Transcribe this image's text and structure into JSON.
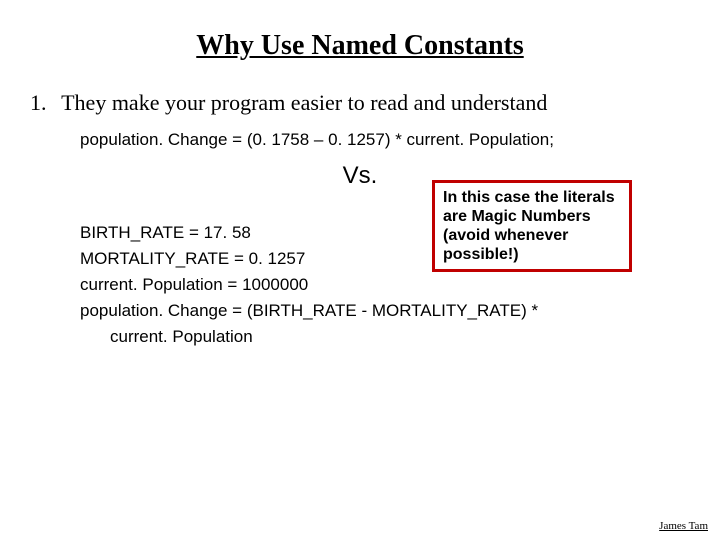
{
  "title": "Why Use Named Constants",
  "bullet": {
    "number": "1.",
    "text": "They make your program easier to read and understand"
  },
  "code_line_1": "population. Change = (0. 1758 – 0. 1257) * current. Population;",
  "vs_label": "Vs.",
  "code_block": {
    "l1": "BIRTH_RATE = 17. 58",
    "l2": "MORTALITY_RATE = 0. 1257",
    "l3": "current. Population = 1000000",
    "l4": "population. Change = (BIRTH_RATE - MORTALITY_RATE) *",
    "l5": "current. Population"
  },
  "callout_text": "In this case the literals are Magic Numbers (avoid whenever possible!)",
  "author": "James Tam"
}
